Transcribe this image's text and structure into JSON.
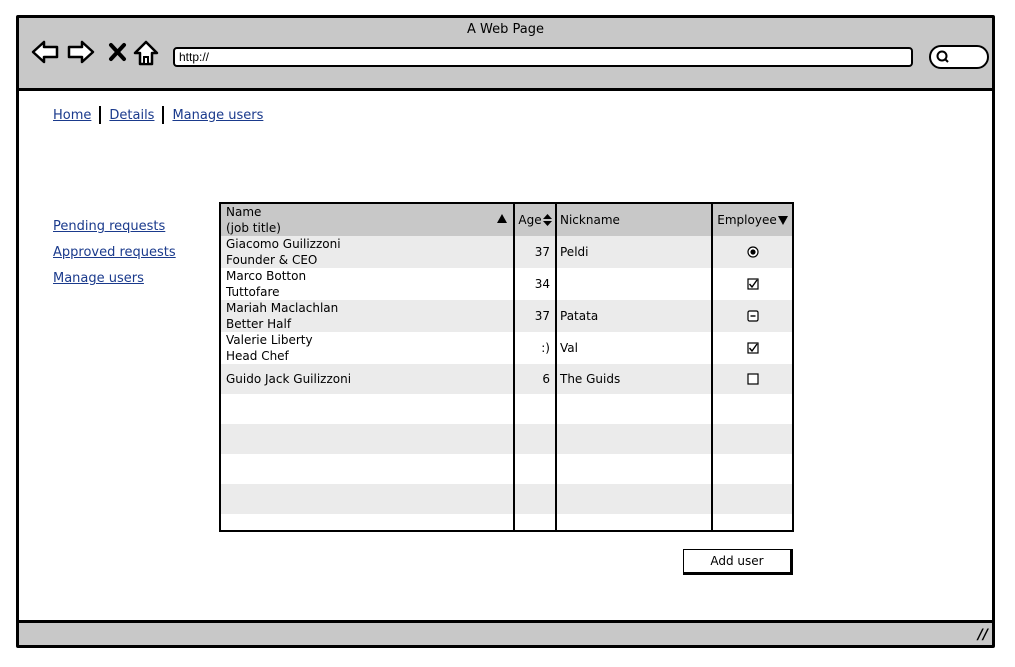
{
  "window": {
    "title": "A Web Page"
  },
  "addressbar": {
    "url": "http://"
  },
  "breadcrumb": [
    "Home",
    "Details",
    "Manage users"
  ],
  "sidebar": {
    "items": [
      "Pending requests",
      "Approved requests",
      "Manage users"
    ]
  },
  "table": {
    "headers": {
      "name": "Name",
      "name_sub": "(job title)",
      "age": "Age",
      "nickname": "Nickname",
      "employee": "Employee"
    },
    "rows": [
      {
        "name": "Giacomo Guilizzoni",
        "title": "Founder & CEO",
        "age": "37",
        "nickname": "Peldi",
        "employee": "radio-selected"
      },
      {
        "name": "Marco Botton",
        "title": "Tuttofare",
        "age": "34",
        "nickname": "",
        "employee": "checkbox-checked"
      },
      {
        "name": "Mariah Maclachlan",
        "title": "Better Half",
        "age": "37",
        "nickname": "Patata",
        "employee": "checkbox-indeterminate"
      },
      {
        "name": "Valerie Liberty",
        "title": "Head Chef",
        "age": ":)",
        "nickname": "Val",
        "employee": "checkbox-checked"
      },
      {
        "name": "Guido Jack Guilizzoni",
        "title": "",
        "age": "6",
        "nickname": "The Guids",
        "employee": "checkbox-unchecked"
      }
    ]
  },
  "buttons": {
    "add_user": "Add user"
  }
}
